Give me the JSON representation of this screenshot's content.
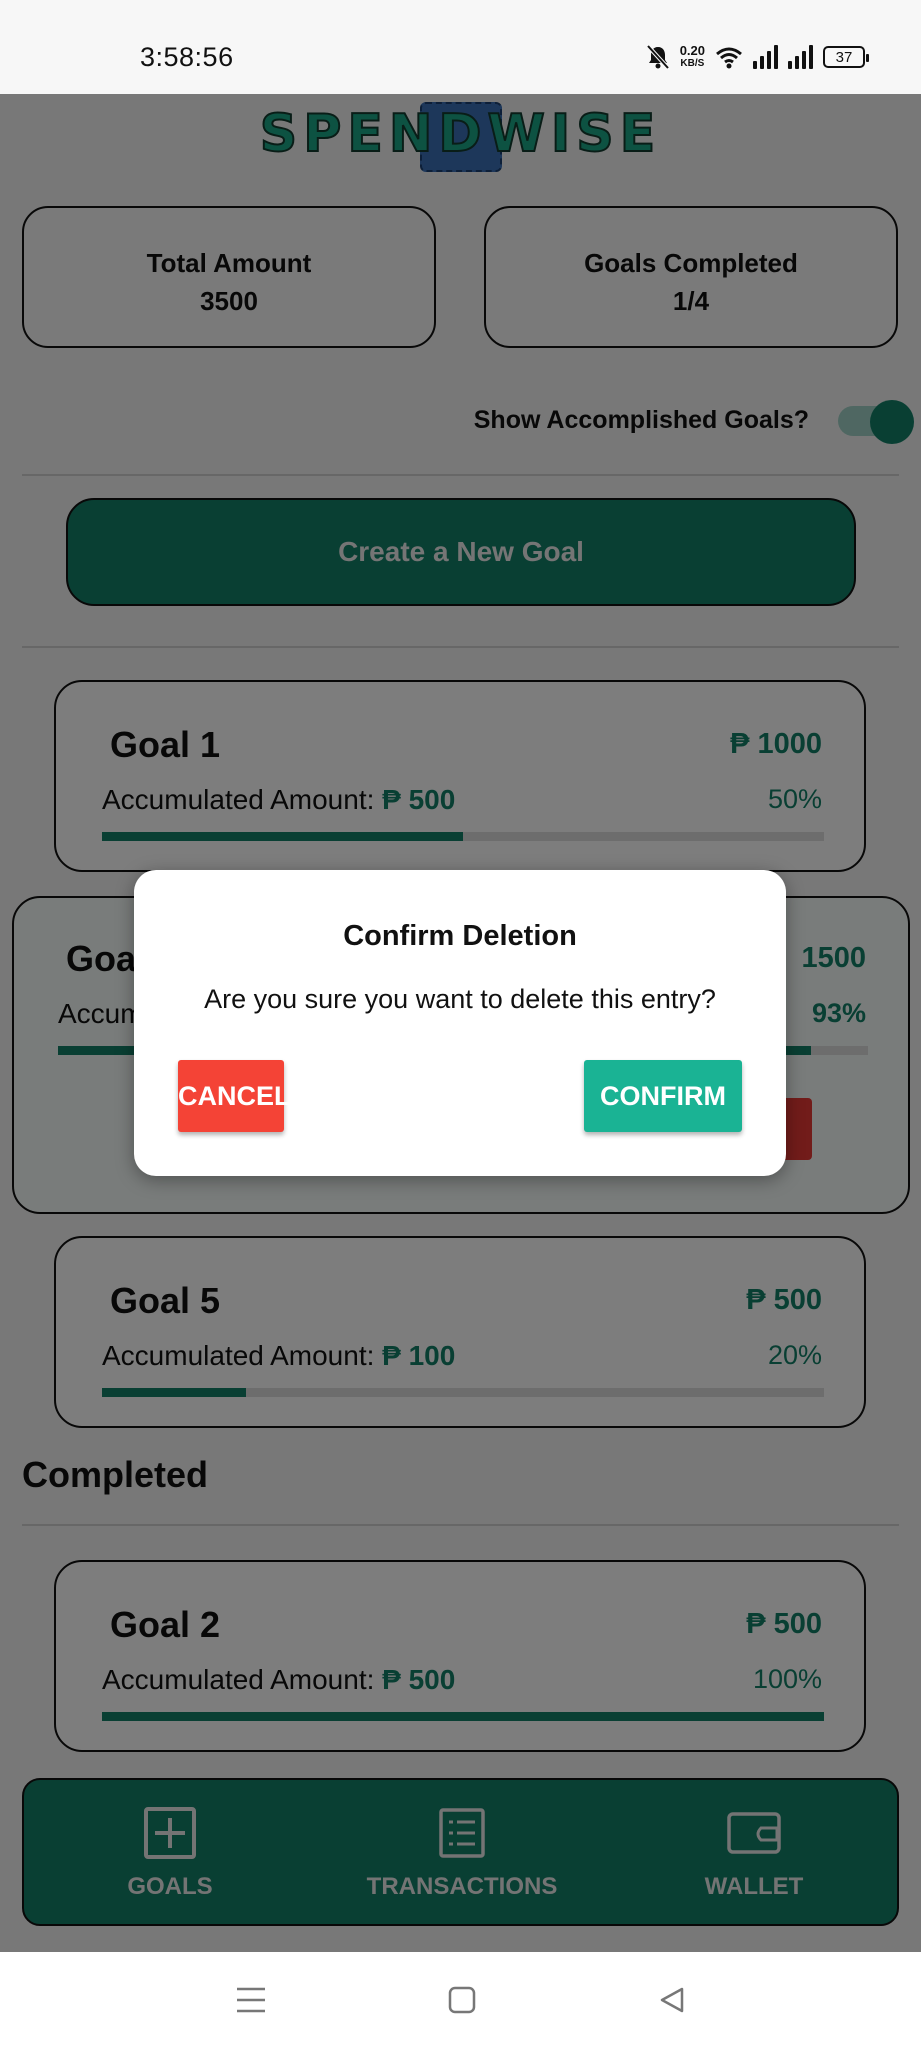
{
  "status_bar": {
    "time": "3:58:56",
    "net_speed_value": "0.20",
    "net_speed_unit": "KB/S",
    "battery": "37"
  },
  "app": {
    "logo_text": "SPENDWISE",
    "total_amount_label": "Total Amount",
    "total_amount_value": "3500",
    "goals_completed_label": "Goals Completed",
    "goals_completed_value": "1/4",
    "toggle_label": "Show Accomplished Goals?",
    "toggle_on": true,
    "create_goal_label": "Create a New Goal",
    "accumulated_label": "Accumulated Amount:",
    "currency": "₱",
    "completed_heading": "Completed"
  },
  "goals": [
    {
      "name": "Goal 1",
      "target": "₱ 1000",
      "accumulated": "₱ 500",
      "percent": "50%",
      "progress": 0.5
    },
    {
      "name": "Goa",
      "target": "1500",
      "accumulated_partial": "Accum",
      "percent": "93%",
      "progress": 0.93
    },
    {
      "name": "Goal 5",
      "target": "₱ 500",
      "accumulated": "₱ 100",
      "percent": "20%",
      "progress": 0.2
    },
    {
      "name": "Goal 2",
      "target": "₱ 500",
      "accumulated": "₱ 500",
      "percent": "100%",
      "progress": 1.0
    }
  ],
  "bottom_nav": {
    "items": [
      {
        "label": "GOALS",
        "icon": "plus-square-icon"
      },
      {
        "label": "TRANSACTIONS",
        "icon": "list-icon"
      },
      {
        "label": "WALLET",
        "icon": "wallet-icon"
      }
    ]
  },
  "dialog": {
    "title": "Confirm Deletion",
    "message": "Are you sure you want to delete this entry?",
    "cancel_label": "CANCEL",
    "confirm_label": "CONFIRM"
  },
  "colors": {
    "primary": "#137e67",
    "cancel": "#f44336",
    "confirm": "#1ab394"
  }
}
